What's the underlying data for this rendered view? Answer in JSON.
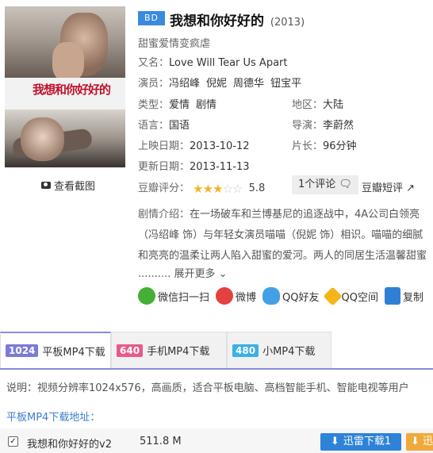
{
  "movie": {
    "badge": "BD",
    "title": "我想和你好好的",
    "year": "(2013)",
    "tagline": "甜蜜爱情变疯虐",
    "poster_title": "我想和你好好的"
  },
  "info": {
    "alias_label": "又名：",
    "alias": "Love Will Tear Us Apart",
    "cast_label": "演员：",
    "cast": [
      "冯绍峰",
      "倪妮",
      "周德华",
      "钮宝平"
    ],
    "genre_label": "类型：",
    "genres": [
      "爱情",
      "剧情"
    ],
    "region_label": "地区：",
    "region": "大陆",
    "lang_label": "语言：",
    "lang": "国语",
    "director_label": "导演：",
    "director": "李蔚然",
    "release_label": "上映日期：",
    "release": "2013-10-12",
    "duration_label": "片长：",
    "duration": "96分钟",
    "update_label": "更新日期：",
    "update": "2013-11-13",
    "douban_label": "豆瓣评分：",
    "douban_score": "5.8",
    "stars_filled": 3,
    "stars_total": 5,
    "comment_button": "1个评论",
    "short_review": "豆瓣短评"
  },
  "plot": {
    "label": "剧情介绍：",
    "text": "在一场破车和兰博基尼的追逐战中，4A公司白领亮（冯绍峰 饰）与年轻女演员喵喵（倪妮 饰）相识。喵喵的细腻和亮亮的温柔让两人陷入甜蜜的爱河。两人的同居生活温馨甜蜜",
    "more": ".......... 展开更多"
  },
  "share": {
    "wechat": "微信扫一扫",
    "weibo": "微博",
    "qq": "QQ好友",
    "qzone": "QQ空间",
    "copy": "复制"
  },
  "tabs": [
    {
      "badge": "1024",
      "label": "平板MP4下载",
      "color": "#7b7bd6"
    },
    {
      "badge": "640",
      "label": "手机MP4下载",
      "color": "#e85a8a"
    },
    {
      "badge": "480",
      "label": "小MP4下载",
      "color": "#3ab0e8"
    }
  ],
  "download": {
    "desc": "说明：视频分辨率1024x576，高画质，适合平板电脑、高档智能手机、智能电视等用户",
    "heading": "平板MP4下载地址：",
    "file_name": "我想和你好好的v2",
    "file_size": "511.8 M",
    "xunlei_button": "迅雷下载1",
    "second_button": "迅"
  },
  "colors": {
    "accent": "#3a8ae0",
    "star": "#f5b324",
    "tab_line": "#8b8bd8",
    "link": "#3a7ecf"
  }
}
